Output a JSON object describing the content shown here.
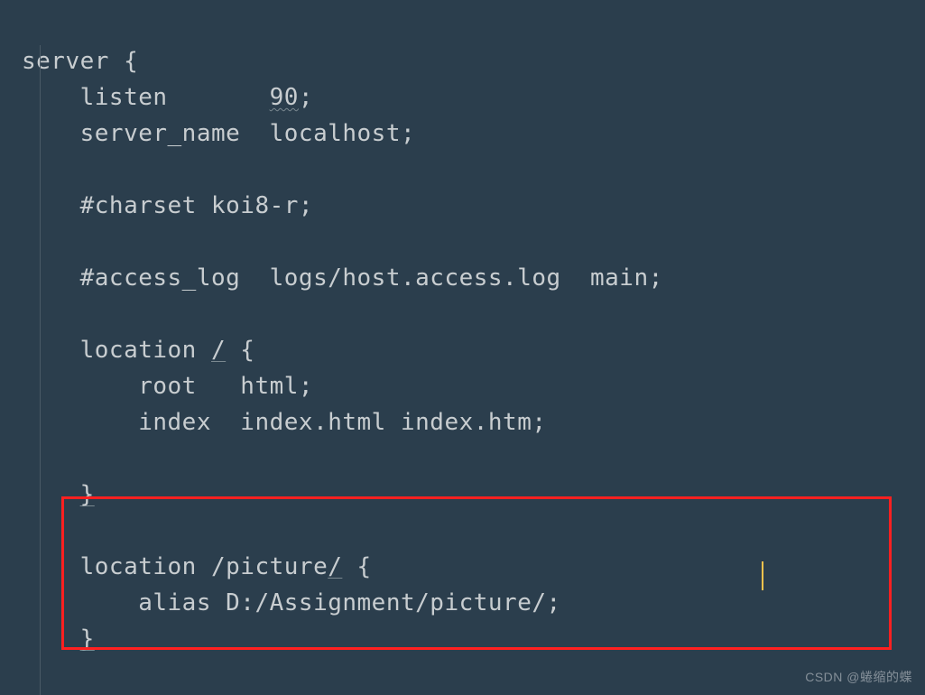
{
  "code": {
    "line1": "server {",
    "line2a": "    listen       ",
    "line2b": "90",
    "line2c": ";",
    "line3": "    server_name  localhost;",
    "line4": "",
    "line5": "    #charset koi8-r;",
    "line6": "",
    "line7": "    #access_log  logs/host.access.log  main;",
    "line8": "",
    "line9a": "    location ",
    "line9b": "/",
    "line9c": " {",
    "line10": "        root   html;",
    "line11": "        index  index.html index.htm;",
    "line12": "",
    "line13a": "    ",
    "line13b": "}",
    "line14": "",
    "line15a": "    location /picture",
    "line15b": "/",
    "line15c": " {",
    "line16a": "        alias D:/Assignment/picture/",
    "line16b": ";",
    "line17a": "    ",
    "line17b": "}"
  },
  "watermark": "CSDN @蜷缩的蝶"
}
